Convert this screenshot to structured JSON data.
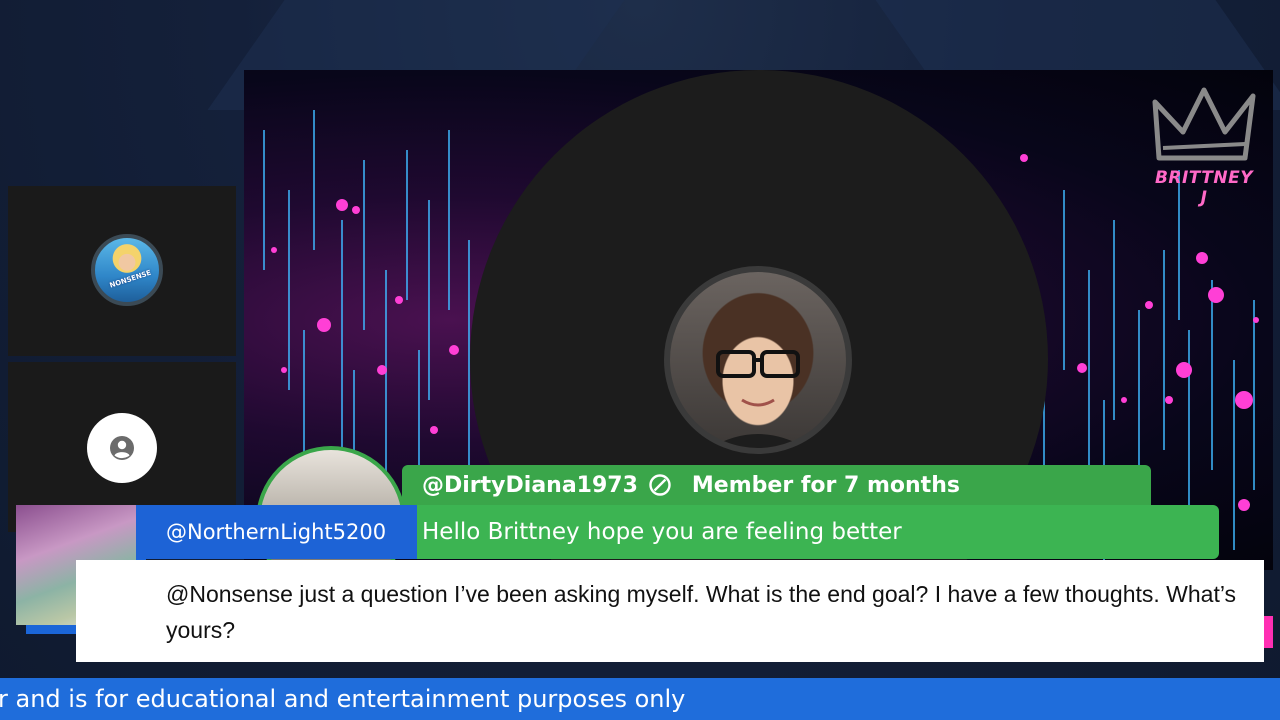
{
  "brand": {
    "label": "BRITTNEY J",
    "icon": "crown-icon",
    "color": "#ff69c7"
  },
  "participants": [
    {
      "avatar_text": "NONSENSE",
      "icon": "avatar"
    },
    {
      "icon": "person-placeholder-icon"
    }
  ],
  "member_message": {
    "username": "@DirtyDiana1973",
    "badge_icon": "verified-badge-icon",
    "member_since": "Member for 7 months",
    "message": "Hello Brittney hope you are feeling better",
    "color": "#3cb452"
  },
  "question": {
    "username": "@NorthernLight5200",
    "source_icon": "youtube-icon",
    "text": "@Nonsense just a question I’ve been asking myself. What is the end goal? I have a few thoughts. What’s yours?",
    "accent_color": "#1d63d6"
  },
  "ticker": {
    "text": "r and is for educational and entertainment purposes only"
  }
}
